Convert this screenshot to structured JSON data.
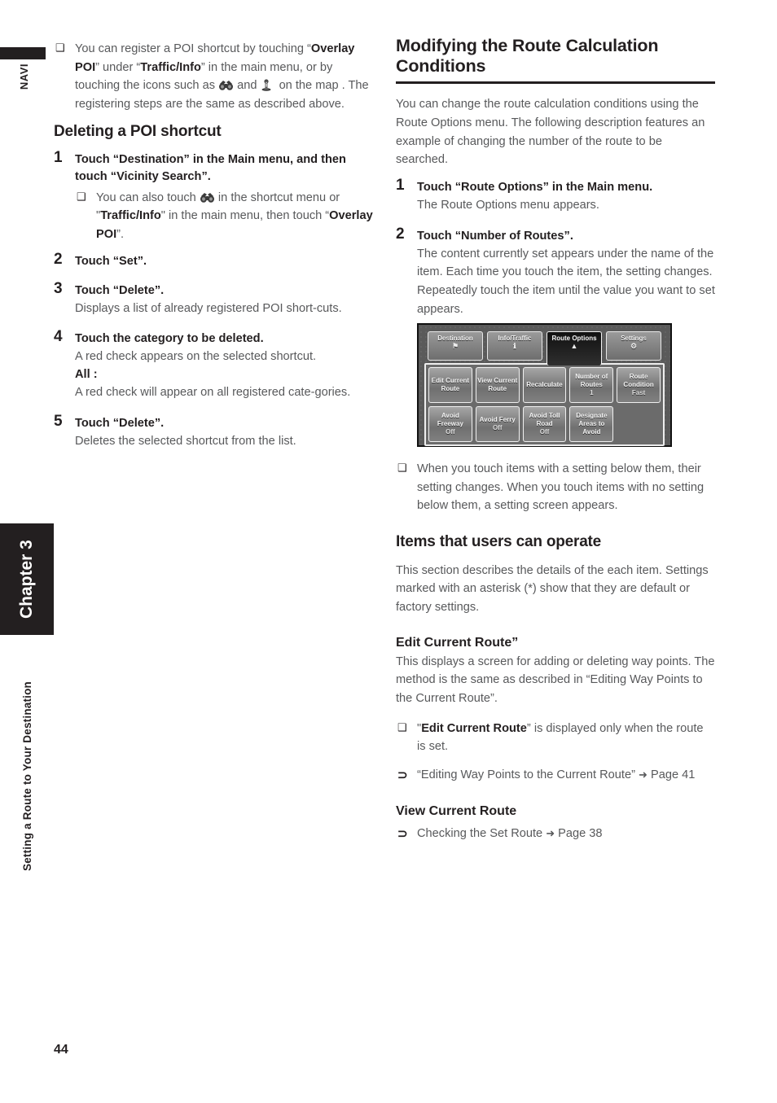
{
  "sidebar": {
    "navi_label": "NAVI",
    "chapter_label": "Chapter 3",
    "chapter_subtitle": "Setting a Route to Your Destination",
    "page_number": "44"
  },
  "left_column": {
    "intro_note": {
      "marker": "square-bullet",
      "text_part1": "You can register a POI shortcut by touching “",
      "bold1": "Overlay POI",
      "text_part2": "” under “",
      "bold2": "Traffic/Info",
      "text_part3": "” in the main menu, or by touching the icons such as ",
      "icon1": "binoculars-icon",
      "text_part4": " and ",
      "icon2": "info-marker-icon",
      "text_part5": " on the map . The registering steps are the same as described above."
    },
    "heading": "Deleting a POI shortcut",
    "steps": [
      {
        "num": "1",
        "title": "Touch “Destination” in the Main menu, and then touch “Vicinity Search”.",
        "note": {
          "text_part1": "You can also touch ",
          "icon": "binoculars-icon",
          "text_part2": " in the shortcut menu or \"",
          "bold1": "Traffic/Info",
          "text_part3": "\" in the main menu, then touch “",
          "bold2": "Overlay POI",
          "text_part4": "”."
        }
      },
      {
        "num": "2",
        "title": "Touch “Set”."
      },
      {
        "num": "3",
        "title": "Touch “Delete”.",
        "body": "Displays a list of already registered POI short-cuts."
      },
      {
        "num": "4",
        "title": "Touch the category to be deleted.",
        "body": "A red check appears on the selected shortcut.",
        "sub_label": "All :",
        "body2": "A red check will appear on all registered cate-gories."
      },
      {
        "num": "5",
        "title": "Touch “Delete”.",
        "body": "Deletes the selected shortcut from the list."
      }
    ]
  },
  "right_column": {
    "heading": "Modifying the Route Calculation Conditions",
    "intro": "You can change the route calculation conditions using the Route Options menu. The following description features an example of changing the number of the route to be searched.",
    "steps": [
      {
        "num": "1",
        "title": "Touch “Route Options” in the Main menu.",
        "body": "The Route Options menu appears."
      },
      {
        "num": "2",
        "title": "Touch “Number of Routes”.",
        "body": "The content currently set appears under the name of the item. Each time you touch the item, the setting changes. Repeatedly touch the item until the value you want to set appears."
      }
    ],
    "screenshot": {
      "tabs": [
        {
          "label": "Destination",
          "icon": "checkered-flag-icon",
          "active": false
        },
        {
          "label": "Info/Traffic",
          "icon": "info-marker-icon",
          "active": false
        },
        {
          "label": "Route Options",
          "icon": "route-fork-icon",
          "active": true
        },
        {
          "label": "Settings",
          "icon": "gear-wrench-icon",
          "active": false
        }
      ],
      "buttons_row1": [
        {
          "label": "Edit Current Route",
          "setting": ""
        },
        {
          "label": "View Current Route",
          "setting": ""
        },
        {
          "label": "Recalculate",
          "setting": ""
        },
        {
          "label": "Number of Routes",
          "setting": "1"
        },
        {
          "label": "Route Condition",
          "setting": "Fast"
        }
      ],
      "buttons_row2": [
        {
          "label": "Avoid Freeway",
          "setting": "Off"
        },
        {
          "label": "Avoid Ferry",
          "setting": "Off"
        },
        {
          "label": "Avoid Toll Road",
          "setting": "Off"
        },
        {
          "label": "Designate Areas to Avoid",
          "setting": ""
        }
      ]
    },
    "screenshot_note": "When you touch items with a setting below them, their setting changes. When you touch items with no setting below them, a setting screen appears.",
    "heading2": "Items that users can operate",
    "intro2": "This section describes the details of the each item. Settings marked with an asterisk (*) show that they are default or factory settings.",
    "subheading1": "Edit Current Route”",
    "para1": "This displays a screen for adding or deleting way points. The method is the same as described in “Editing Way Points to the Current Route”.",
    "note1": {
      "bold": "Edit Current Route",
      "prefix": "\"",
      "suffix": "” is displayed only when the route is set."
    },
    "ref1": {
      "text": "“Editing Way Points to the Current Route”",
      "page": "Page 41"
    },
    "subheading2": "View Current Route",
    "ref2": {
      "text": "Checking the Set Route",
      "page": "Page 38"
    }
  }
}
